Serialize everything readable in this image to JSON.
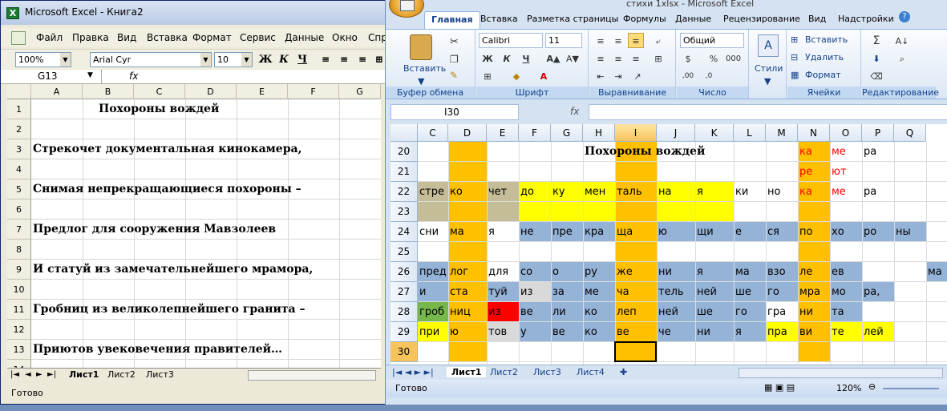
{
  "left_window": {
    "title": "Microsoft Excel - Книга2",
    "menu": [
      "Файл",
      "Правка",
      "Вид",
      "Вставка",
      "Формат",
      "Сервис",
      "Данные",
      "Окно",
      "Спр"
    ],
    "toolbar": {
      "zoom": "100%",
      "font": "Arial Cyr",
      "size": "10",
      "bold": "Ж",
      "italic": "К",
      "underline": "Ч"
    },
    "name_box": "G13",
    "fx": "fx",
    "columns": [
      "A",
      "B",
      "C",
      "D",
      "E",
      "F",
      "G"
    ],
    "rows": [
      "1",
      "2",
      "3",
      "4",
      "5",
      "6",
      "7",
      "8",
      "9",
      "10",
      "11",
      "12",
      "13",
      "14"
    ],
    "lines": {
      "r1": "Похороны    вождей",
      "r3": "Стрекочет    документальная    кинокамера,",
      "r5": "Снимая    непрекращающиеся    похороны –",
      "r7": "Предлог    для    сооружения    Мавзолеев",
      "r9": "И    статуй    из    замечательнейшего    мрамора,",
      "r11": "Гробниц    из    великолепнейшего    гранита –",
      "r13": "Приютов    увековечения    правителей…"
    },
    "sheet_tabs": [
      "Лист1",
      "Лист2",
      "Лист3"
    ],
    "status": "Готово"
  },
  "right_window": {
    "title": "стихи 1xlsx - Microsoft Excel",
    "ribbon_tabs": [
      "Главная",
      "Вставка",
      "Разметка страницы",
      "Формулы",
      "Данные",
      "Рецензирование",
      "Вид",
      "Надстройки"
    ],
    "clipboard": {
      "paste": "Вставить",
      "label": "Буфер обмена"
    },
    "font": {
      "name": "Calibri",
      "size": "11",
      "label": "Шрифт",
      "bold": "Ж",
      "italic": "К",
      "underline": "Ч"
    },
    "alignment": {
      "label": "Выравнивание"
    },
    "number": {
      "format": "Общий",
      "label": "Число",
      "pct": "%",
      "thousands": "000",
      "currency": "$"
    },
    "styles": {
      "label": "Стили"
    },
    "cells": {
      "insert": "Вставить",
      "delete": "Удалить",
      "format": "Формат",
      "label": "Ячейки"
    },
    "editing": {
      "label": "Редактирование"
    },
    "name_box": "I30",
    "fx": "fx",
    "columns": [
      "C",
      "D",
      "E",
      "F",
      "G",
      "H",
      "I",
      "J",
      "K",
      "L",
      "M",
      "N",
      "O",
      "P",
      "Q"
    ],
    "rows": [
      "20",
      "21",
      "22",
      "23",
      "24",
      "25",
      "26",
      "27",
      "28",
      "29",
      "30"
    ],
    "title_cell": "Похороны    вождей",
    "cells_data": [
      {
        "r": 0,
        "c": "N",
        "t": "ка",
        "col": "#ff0000"
      },
      {
        "r": 0,
        "c": "O",
        "t": "ме",
        "col": "#ff0000"
      },
      {
        "r": 0,
        "c": "P",
        "t": "ра"
      },
      {
        "r": 1,
        "c": "N",
        "t": "ре",
        "col": "#ff0000"
      },
      {
        "r": 1,
        "c": "O",
        "t": "ют",
        "col": "#ff0000"
      },
      {
        "r": 2,
        "c": "C",
        "t": "стре"
      },
      {
        "r": 2,
        "c": "D",
        "t": "ко"
      },
      {
        "r": 2,
        "c": "E",
        "t": "чет"
      },
      {
        "r": 2,
        "c": "F",
        "t": "до"
      },
      {
        "r": 2,
        "c": "G",
        "t": "ку"
      },
      {
        "r": 2,
        "c": "H",
        "t": "мен"
      },
      {
        "r": 2,
        "c": "I",
        "t": "таль"
      },
      {
        "r": 2,
        "c": "J",
        "t": "на"
      },
      {
        "r": 2,
        "c": "K",
        "t": "я"
      },
      {
        "r": 2,
        "c": "L",
        "t": "ки"
      },
      {
        "r": 2,
        "c": "M",
        "t": "но"
      },
      {
        "r": 2,
        "c": "N",
        "t": "ка",
        "col": "#ff0000"
      },
      {
        "r": 2,
        "c": "O",
        "t": "ме",
        "col": "#ff0000"
      },
      {
        "r": 2,
        "c": "P",
        "t": "ра"
      },
      {
        "r": 4,
        "c": "C",
        "t": "сни"
      },
      {
        "r": 4,
        "c": "D",
        "t": "ма"
      },
      {
        "r": 4,
        "c": "E",
        "t": "я"
      },
      {
        "r": 4,
        "c": "F",
        "t": "не"
      },
      {
        "r": 4,
        "c": "G",
        "t": "пре"
      },
      {
        "r": 4,
        "c": "H",
        "t": "кра"
      },
      {
        "r": 4,
        "c": "I",
        "t": "ща"
      },
      {
        "r": 4,
        "c": "J",
        "t": "ю"
      },
      {
        "r": 4,
        "c": "K",
        "t": "щи"
      },
      {
        "r": 4,
        "c": "L",
        "t": "е"
      },
      {
        "r": 4,
        "c": "M",
        "t": "ся"
      },
      {
        "r": 4,
        "c": "N",
        "t": "по"
      },
      {
        "r": 4,
        "c": "O",
        "t": "хо"
      },
      {
        "r": 4,
        "c": "P",
        "t": "ро"
      },
      {
        "r": 4,
        "c": "Q",
        "t": "ны"
      },
      {
        "r": 6,
        "c": "C",
        "t": "пред"
      },
      {
        "r": 6,
        "c": "D",
        "t": "лог"
      },
      {
        "r": 6,
        "c": "E",
        "t": "для"
      },
      {
        "r": 6,
        "c": "F",
        "t": "со"
      },
      {
        "r": 6,
        "c": "G",
        "t": "о"
      },
      {
        "r": 6,
        "c": "H",
        "t": "ру"
      },
      {
        "r": 6,
        "c": "I",
        "t": "же"
      },
      {
        "r": 6,
        "c": "J",
        "t": "ни"
      },
      {
        "r": 6,
        "c": "K",
        "t": "я"
      },
      {
        "r": 6,
        "c": "L",
        "t": "ма"
      },
      {
        "r": 6,
        "c": "M",
        "t": "взо"
      },
      {
        "r": 6,
        "c": "N",
        "t": "ле"
      },
      {
        "r": 6,
        "c": "O",
        "t": "ев"
      },
      {
        "r": 6,
        "c": "R",
        "t": "ма"
      },
      {
        "r": 7,
        "c": "C",
        "t": "и"
      },
      {
        "r": 7,
        "c": "D",
        "t": "ста"
      },
      {
        "r": 7,
        "c": "E",
        "t": "туй"
      },
      {
        "r": 7,
        "c": "F",
        "t": "из"
      },
      {
        "r": 7,
        "c": "G",
        "t": "за"
      },
      {
        "r": 7,
        "c": "H",
        "t": "ме"
      },
      {
        "r": 7,
        "c": "I",
        "t": "ча"
      },
      {
        "r": 7,
        "c": "J",
        "t": "тель"
      },
      {
        "r": 7,
        "c": "K",
        "t": "ней"
      },
      {
        "r": 7,
        "c": "L",
        "t": "ше"
      },
      {
        "r": 7,
        "c": "M",
        "t": "го"
      },
      {
        "r": 7,
        "c": "N",
        "t": "мра"
      },
      {
        "r": 7,
        "c": "O",
        "t": "мо"
      },
      {
        "r": 7,
        "c": "P",
        "t": "ра,"
      },
      {
        "r": 8,
        "c": "C",
        "t": "гроб"
      },
      {
        "r": 8,
        "c": "D",
        "t": "ниц"
      },
      {
        "r": 8,
        "c": "E",
        "t": "из"
      },
      {
        "r": 8,
        "c": "F",
        "t": "ве"
      },
      {
        "r": 8,
        "c": "G",
        "t": "ли"
      },
      {
        "r": 8,
        "c": "H",
        "t": "ко"
      },
      {
        "r": 8,
        "c": "I",
        "t": "леп"
      },
      {
        "r": 8,
        "c": "J",
        "t": "ней"
      },
      {
        "r": 8,
        "c": "K",
        "t": "ше"
      },
      {
        "r": 8,
        "c": "L",
        "t": "го"
      },
      {
        "r": 8,
        "c": "M",
        "t": "гра"
      },
      {
        "r": 8,
        "c": "N",
        "t": "ни"
      },
      {
        "r": 8,
        "c": "O",
        "t": "та"
      },
      {
        "r": 9,
        "c": "C",
        "t": "при"
      },
      {
        "r": 9,
        "c": "D",
        "t": "ю"
      },
      {
        "r": 9,
        "c": "E",
        "t": "тов"
      },
      {
        "r": 9,
        "c": "F",
        "t": "у"
      },
      {
        "r": 9,
        "c": "G",
        "t": "ве"
      },
      {
        "r": 9,
        "c": "H",
        "t": "ко"
      },
      {
        "r": 9,
        "c": "I",
        "t": "ве"
      },
      {
        "r": 9,
        "c": "J",
        "t": "че"
      },
      {
        "r": 9,
        "c": "K",
        "t": "ни"
      },
      {
        "r": 9,
        "c": "L",
        "t": "я"
      },
      {
        "r": 9,
        "c": "M",
        "t": "пра"
      },
      {
        "r": 9,
        "c": "N",
        "t": "ви"
      },
      {
        "r": 9,
        "c": "O",
        "t": "те"
      },
      {
        "r": 9,
        "c": "P",
        "t": "лей"
      }
    ],
    "sheet_tabs": [
      "Лист1",
      "Лист2",
      "Лист3",
      "Лист4"
    ],
    "status": "Готово",
    "zoom": "120%",
    "colors": {
      "orange": "#ffc000",
      "yellow": "#ffff00",
      "blue": "#95b3d7",
      "tan": "#c4bd97",
      "green": "#77b84a",
      "red": "#ff0000",
      "gray": "#d9d9d9"
    }
  }
}
